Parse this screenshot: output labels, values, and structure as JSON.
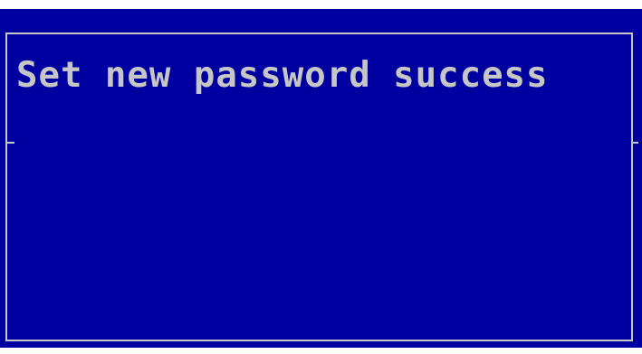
{
  "dialog": {
    "message": "Set new password success"
  },
  "colors": {
    "background": "#0000a0",
    "foreground": "#c6c6c6"
  }
}
